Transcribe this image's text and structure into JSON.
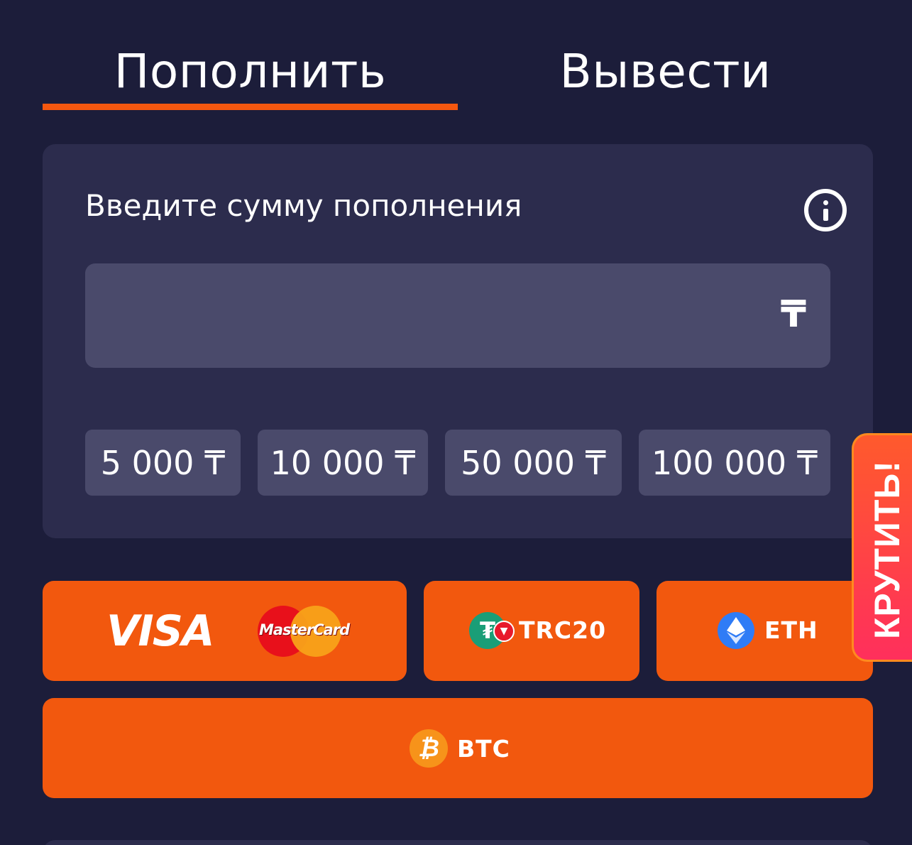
{
  "tabs": {
    "deposit": "Пополнить",
    "withdraw": "Вывести",
    "active": "deposit"
  },
  "amount_card": {
    "title": "Введите сумму пополнения",
    "input_value": "",
    "currency_sign": "₸",
    "info_icon": "info-icon",
    "presets": [
      "5 000 ₸",
      "10 000 ₸",
      "50 000 ₸",
      "100 000 ₸"
    ]
  },
  "payment_methods": {
    "card": {
      "visa": "VISA",
      "mastercard": "MasterCard"
    },
    "trc20": {
      "label": "TRC20",
      "icon": "tether-tron-icon"
    },
    "eth": {
      "label": "ETH",
      "icon": "ethereum-icon"
    },
    "btc": {
      "label": "BTC",
      "icon": "bitcoin-icon"
    }
  },
  "spin_tab": {
    "label": "КРУТИТЬ!"
  },
  "colors": {
    "background": "#1c1d3a",
    "card": "#2c2c4d",
    "field": "#4a4a6b",
    "accent": "#f2580e"
  }
}
